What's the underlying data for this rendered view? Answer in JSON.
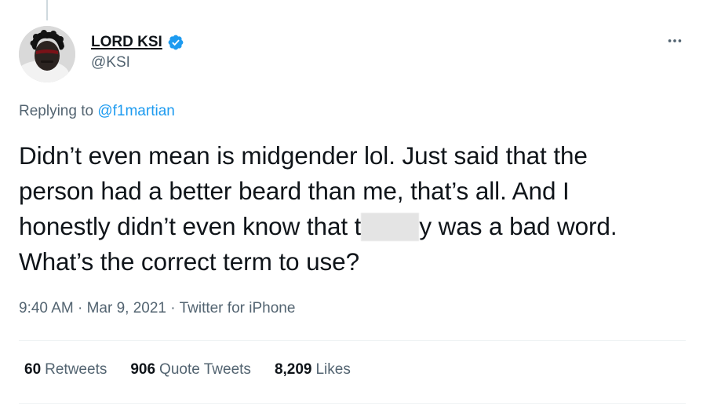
{
  "author": {
    "display_name": "LORD KSI",
    "handle": "@KSI",
    "verified": true
  },
  "reply": {
    "prefix": "Replying to",
    "to": "@f1martian"
  },
  "tweet": {
    "line1": "Didn’t even mean is midgender lol. Just said that the",
    "line2": "person had a better beard than me, that’s all. And I",
    "line3_before": "honestly didn’t even know that t",
    "line3_after": "y was a bad word.",
    "line4": "What’s the correct term to use?"
  },
  "meta": {
    "time": "9:40 AM",
    "separator1": " · ",
    "date": "Mar 9, 2021",
    "separator2": " · ",
    "source": "Twitter for iPhone"
  },
  "stats": {
    "retweets_count": "60",
    "retweets_label": "Retweets",
    "quotes_count": "906",
    "quotes_label": "Quote Tweets",
    "likes_count": "8,209",
    "likes_label": "Likes"
  },
  "colors": {
    "accent": "#1d9bf0",
    "text_primary": "#0f1419",
    "text_secondary": "#536471",
    "divider": "#eff3f4"
  },
  "icons": {
    "verified": "verified-badge-icon",
    "more": "more-horizontal-icon"
  }
}
